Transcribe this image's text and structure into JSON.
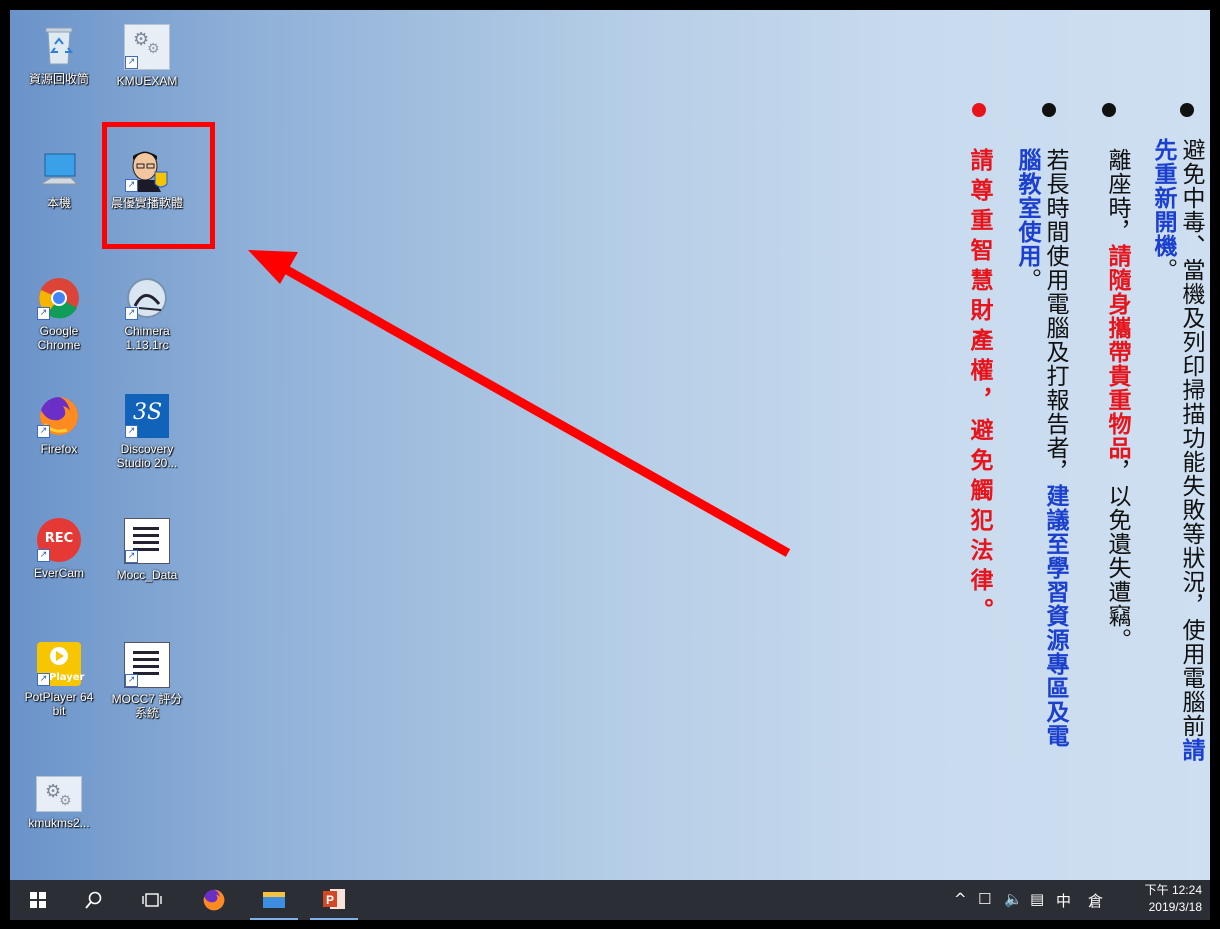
{
  "desktop_icons": [
    {
      "label": "資源回收筒"
    },
    {
      "label": "KMUEXAM"
    },
    {
      "label": "本機"
    },
    {
      "label": "晨優實播軟體"
    },
    {
      "label": "Google Chrome"
    },
    {
      "label": "Chimera 1.13.1rc"
    },
    {
      "label": "Firefox"
    },
    {
      "label": "Discovery Studio 20..."
    },
    {
      "label": "EverCam"
    },
    {
      "label": "Mocc_Data"
    },
    {
      "label": "PotPlayer 64 bit"
    },
    {
      "label": "MOCC7 評分系統"
    },
    {
      "label": "kmukms2..."
    }
  ],
  "icon_glyphs": {
    "rec": "REC",
    "player": "Player",
    "ds": "3S"
  },
  "notice": {
    "col1": {
      "black_a": "避免中毒、當機及列印掃描功能失敗等狀況，使用電腦前",
      "blue": "請先重新開機",
      "black_b": "。"
    },
    "col2": {
      "black_a": "離座時，",
      "red": "請隨身攜帶貴重物品",
      "black_b": "，以免遺失遭竊。"
    },
    "col3": {
      "black_a": "若長時間使用電腦及打報告者，",
      "blue": "建議至學習資源專區及電腦教室使用",
      "black_b": "。"
    },
    "col4": {
      "red": "請尊重智慧財產權，避免觸犯法律。"
    }
  },
  "colors": {
    "red": "#e8141b",
    "blue": "#1b3fcf",
    "black": "#111111",
    "highlight": "#ff0000"
  },
  "taskbar": {
    "tray_icons": [
      "^",
      "☐",
      "🔈",
      "▤",
      "中",
      "倉"
    ],
    "clock_time": "下午 12:24",
    "clock_date": "2019/3/18"
  }
}
